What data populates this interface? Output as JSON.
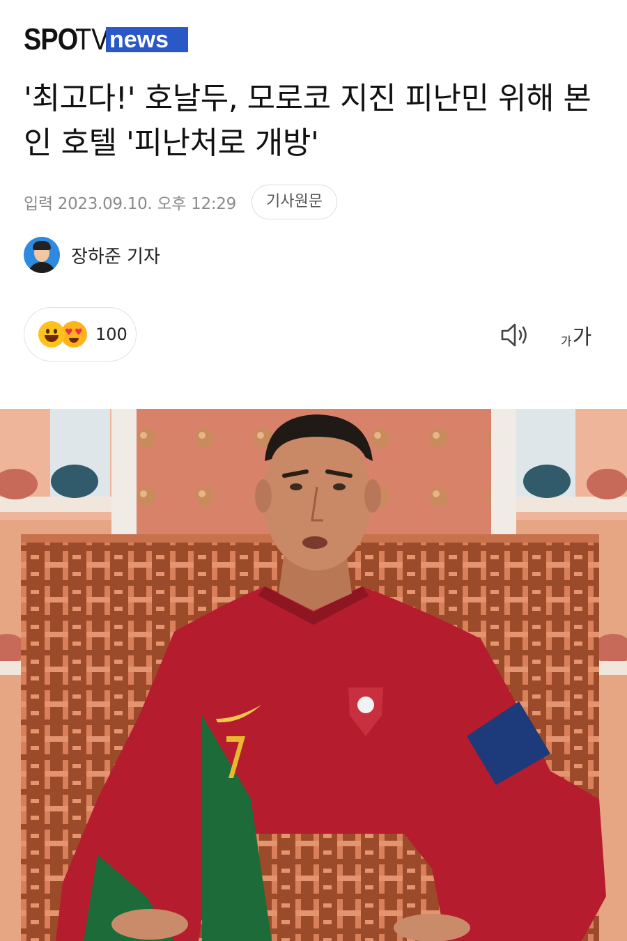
{
  "header": {
    "logo_spo": "SPO",
    "logo_tv": "TV",
    "logo_news": "news"
  },
  "article": {
    "title": "'최고다!' 호날두, 모로코 지진 피난민 위해 본인 호텔 '피난처로 개방'",
    "date": "입력 2023.09.10. 오후 12:29",
    "source_button": "기사원문",
    "author": "장하준 기자"
  },
  "toolbar": {
    "reaction_count": "100",
    "font_small": "가",
    "font_large": "가"
  },
  "icons": [
    "smile-emoji-icon",
    "heart-eyes-emoji-icon",
    "speaker-icon",
    "font-size-icon"
  ],
  "colors": {
    "brand_blue": "#2a58c6",
    "meta_gray": "#8a8a8a",
    "jersey_red": "#b51d2e",
    "jersey_green": "#1e6b3a"
  }
}
